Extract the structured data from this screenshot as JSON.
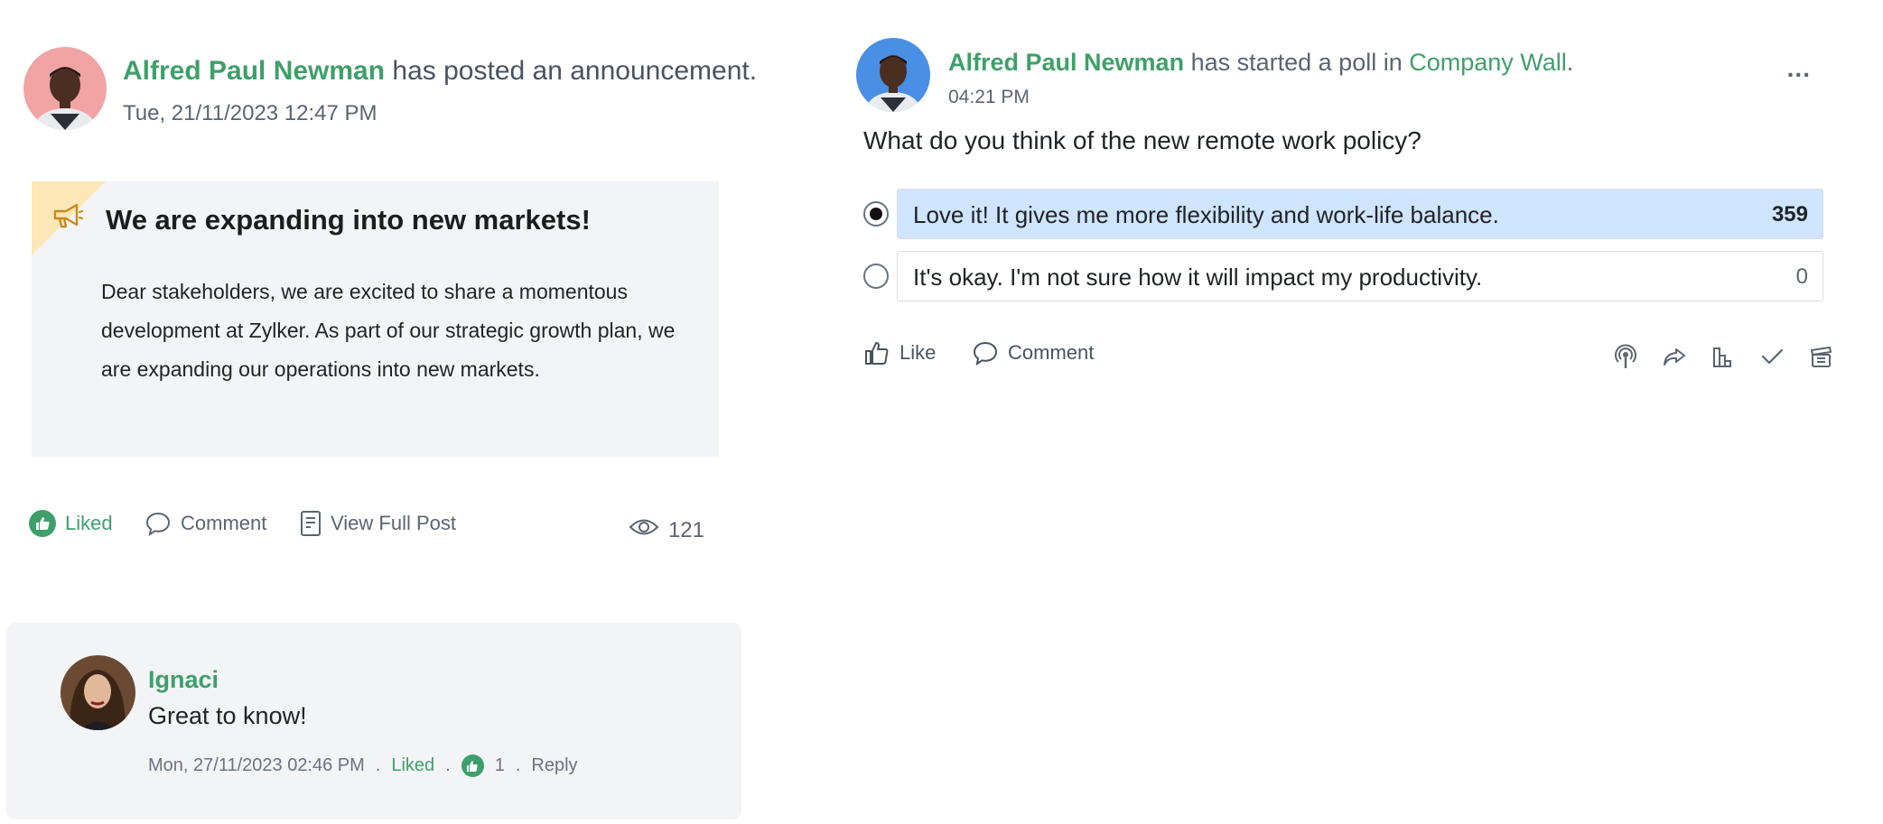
{
  "announcement": {
    "author": "Alfred Paul Newman",
    "action_text": "has posted an announcement.",
    "date": "Tue, 21/11/2023 12:47 PM",
    "title": "We are expanding into new markets!",
    "body": "Dear stakeholders, we are excited to share a momentous development at Zylker. As part of our strategic growth plan, we are expanding our operations into new markets.",
    "actions": {
      "liked_label": "Liked",
      "comment_label": "Comment",
      "view_full_post_label": "View Full Post",
      "views_count": "121"
    }
  },
  "comment": {
    "author": "Ignaci",
    "text": "Great to know!",
    "timestamp": "Mon, 27/11/2023 02:46 PM",
    "separator": ".",
    "liked_label": "Liked",
    "like_count": "1",
    "reply_label": "Reply"
  },
  "poll": {
    "author": "Alfred Paul Newman",
    "action_text": "has started a poll in",
    "group": "Company Wall",
    "period": ".",
    "time": "04:21 PM",
    "more_label": "...",
    "question": "What do you think of the new remote work policy?",
    "options": [
      {
        "label": "Love it! It gives me more flexibility and work-life balance.",
        "votes": "359",
        "selected": true,
        "share": 1.0
      },
      {
        "label": "It's okay. I'm not sure how it will impact my productivity.",
        "votes": "0",
        "selected": false,
        "share": 0.0
      }
    ],
    "actions": {
      "like_label": "Like",
      "comment_label": "Comment"
    },
    "icons": [
      "broadcast-icon",
      "share-icon",
      "poll-results-icon",
      "check-icon",
      "archive-icon"
    ]
  },
  "colors": {
    "accent_green": "#3f9f6b",
    "card_bg": "#f3f4f6",
    "poll_fill": "#cfe4fd",
    "announcement_corner": "#fde7b6",
    "avatar_left_bg": "#f2a3a3",
    "avatar_right_bg": "#4a8fe6"
  }
}
